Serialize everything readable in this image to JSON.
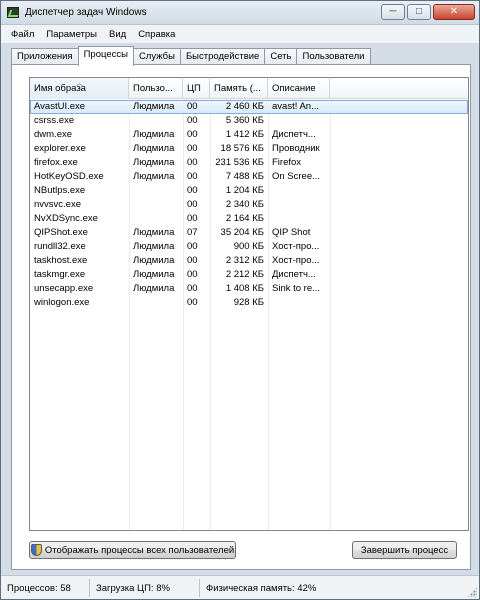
{
  "window": {
    "title": "Диспетчер задач Windows",
    "buttons": {
      "minimize": "─",
      "maximize": "□",
      "close": "✕"
    }
  },
  "menu": [
    "Файл",
    "Параметры",
    "Вид",
    "Справка"
  ],
  "tabs": [
    "Приложения",
    "Процессы",
    "Службы",
    "Быстродействие",
    "Сеть",
    "Пользователи"
  ],
  "active_tab": "Процессы",
  "columns": [
    "Имя образа",
    "Пользо...",
    "ЦП",
    "Память (...",
    "Описание"
  ],
  "sorted_column": "Имя образа",
  "processes": [
    {
      "name": "AvastUI.exe",
      "user": "Людмила",
      "cpu": "00",
      "memory": "2 460 КБ",
      "description": "avast! An...",
      "selected": true
    },
    {
      "name": "csrss.exe",
      "user": "",
      "cpu": "00",
      "memory": "5 360 КБ",
      "description": ""
    },
    {
      "name": "dwm.exe",
      "user": "Людмила",
      "cpu": "00",
      "memory": "1 412 КБ",
      "description": "Диспетч..."
    },
    {
      "name": "explorer.exe",
      "user": "Людмила",
      "cpu": "00",
      "memory": "18 576 КБ",
      "description": "Проводник"
    },
    {
      "name": "firefox.exe",
      "user": "Людмила",
      "cpu": "00",
      "memory": "231 536 КБ",
      "description": "Firefox"
    },
    {
      "name": "HotKeyOSD.exe",
      "user": "Людмила",
      "cpu": "00",
      "memory": "7 488 КБ",
      "description": "On Scree..."
    },
    {
      "name": "NButlps.exe",
      "user": "",
      "cpu": "00",
      "memory": "1 204 КБ",
      "description": ""
    },
    {
      "name": "nvvsvc.exe",
      "user": "",
      "cpu": "00",
      "memory": "2 340 КБ",
      "description": ""
    },
    {
      "name": "NvXDSync.exe",
      "user": "",
      "cpu": "00",
      "memory": "2 164 КБ",
      "description": ""
    },
    {
      "name": "QIPShot.exe",
      "user": "Людмила",
      "cpu": "07",
      "memory": "35 204 КБ",
      "description": "QIP Shot"
    },
    {
      "name": "rundll32.exe",
      "user": "Людмила",
      "cpu": "00",
      "memory": "900 КБ",
      "description": "Хост-про..."
    },
    {
      "name": "taskhost.exe",
      "user": "Людмила",
      "cpu": "00",
      "memory": "2 312 КБ",
      "description": "Хост-про..."
    },
    {
      "name": "taskmgr.exe",
      "user": "Людмила",
      "cpu": "00",
      "memory": "2 212 КБ",
      "description": "Диспетч..."
    },
    {
      "name": "unsecapp.exe",
      "user": "Людмила",
      "cpu": "00",
      "memory": "1 408 КБ",
      "description": "Sink to re..."
    },
    {
      "name": "winlogon.exe",
      "user": "",
      "cpu": "00",
      "memory": "928 КБ",
      "description": ""
    }
  ],
  "buttons": {
    "show_all": "Отображать процессы всех пользователей",
    "end_process": "Завершить процесс"
  },
  "status": {
    "processes": "Процессов: 58",
    "cpu": "Загрузка ЦП: 8%",
    "memory": "Физическая память: 42%"
  }
}
